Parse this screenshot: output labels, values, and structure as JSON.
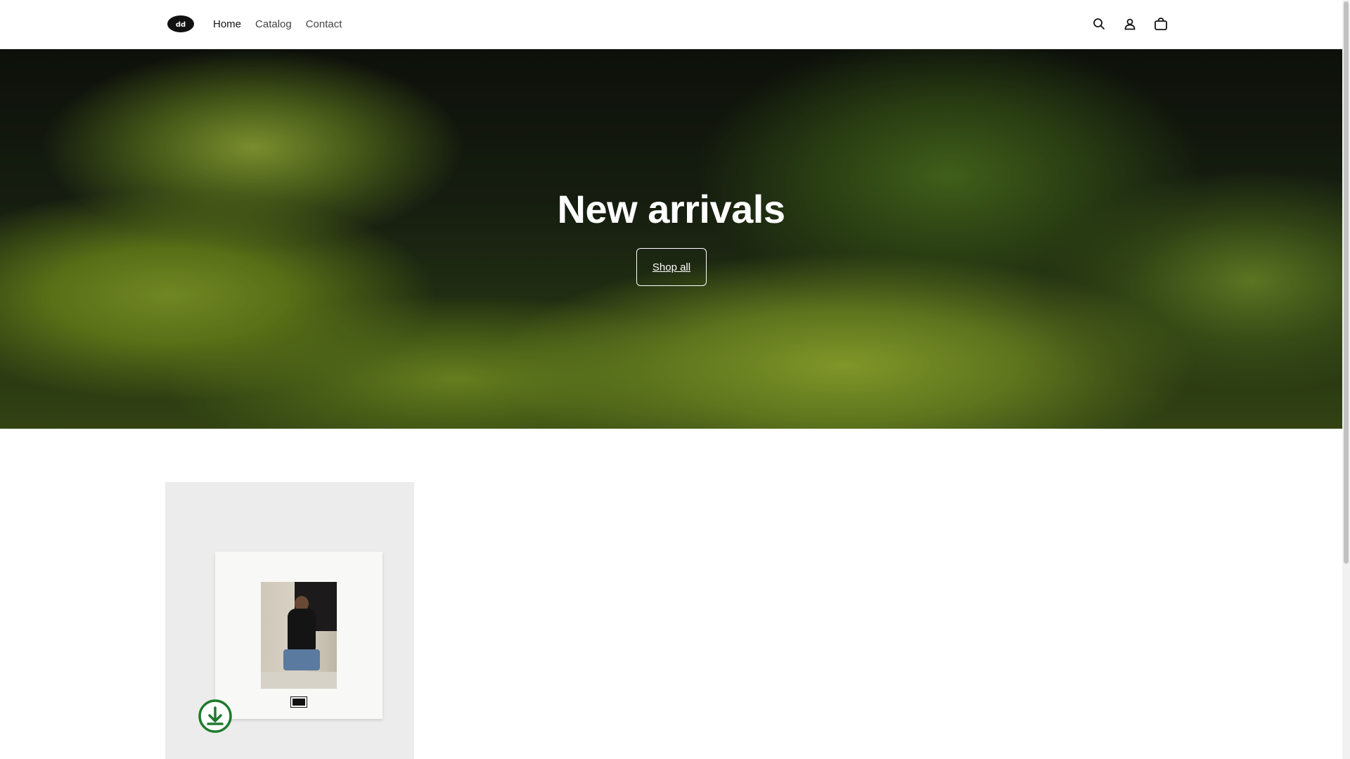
{
  "header": {
    "nav": [
      {
        "label": "Home",
        "active": true
      },
      {
        "label": "Catalog",
        "active": false
      },
      {
        "label": "Contact",
        "active": false
      }
    ],
    "icons": [
      "search-icon",
      "account-icon",
      "cart-icon"
    ]
  },
  "hero": {
    "title": "New arrivals",
    "button_label": "Shop all"
  },
  "product": {
    "advisory_text": "PARENTAL ADVISORY",
    "badge_icon": "download-icon",
    "badge_color": "#1f7a2e"
  }
}
